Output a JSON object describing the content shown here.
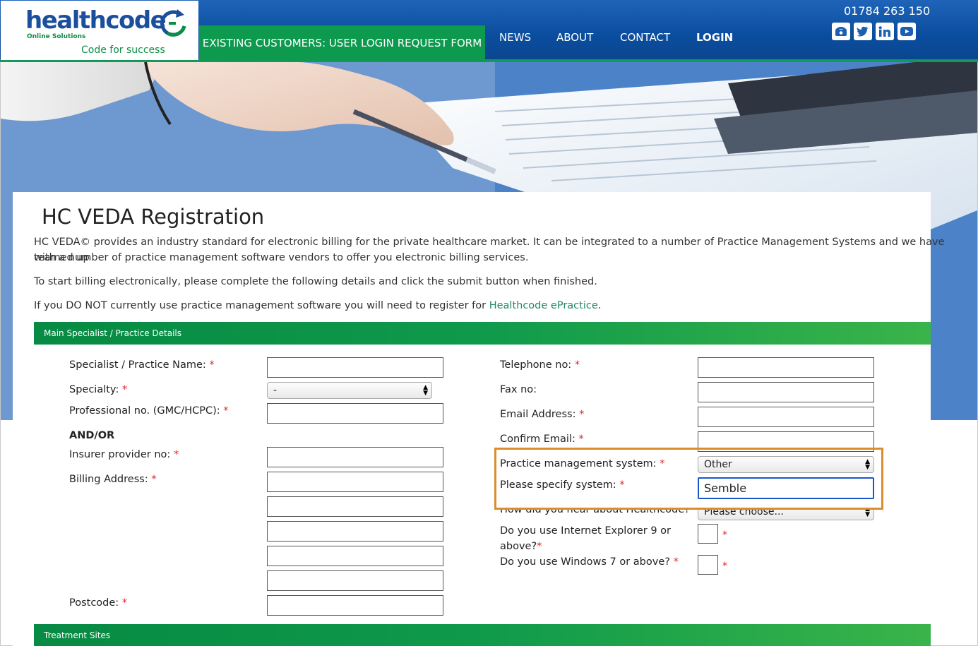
{
  "header": {
    "logo_word": "healthcode",
    "logo_sub": "Online Solutions",
    "logo_tagline": "Code for success",
    "phone": "01784 263 150",
    "nav": {
      "active": "EXISTING CUSTOMERS: USER LOGIN REQUEST FORM",
      "news": "NEWS",
      "about": "ABOUT",
      "contact": "CONTACT",
      "login": "LOGIN"
    }
  },
  "page": {
    "title": "HC VEDA Registration",
    "intro_line1": "HC VEDA© provides an industry standard for electronic billing for the private healthcare market. It can be integrated to a number of Practice Management Systems and we have teamed up",
    "intro_line2": "with a number of practice management software vendors to offer you electronic billing services.",
    "instructions": "To start billing electronically, please complete the following details and click the submit button when finished.",
    "no_pms_text": "If you DO NOT currently use practice management software you will need to register for ",
    "no_pms_link": "Healthcode ePractice",
    "no_pms_end": "."
  },
  "sections": {
    "main": "Main Specialist / Practice Details",
    "treatment": "Treatment Sites"
  },
  "form": {
    "specialist_name": "Specialist / Practice Name:",
    "specialty": "Specialty:",
    "specialty_value": "-",
    "professional_no": "Professional no. (GMC/HCPC):",
    "and_or": "AND/OR",
    "insurer_no": "Insurer provider no:",
    "billing_address": "Billing Address:",
    "postcode": "Postcode:",
    "telephone": "Telephone no:",
    "fax": "Fax no:",
    "email": "Email Address:",
    "confirm_email": "Confirm Email:",
    "pms": "Practice management system:",
    "pms_value": "Other",
    "specify": "Please specify system:",
    "specify_value": "Semble",
    "hear": "How did you hear about Healthcode?",
    "hear_value": "Please choose...",
    "ie9_line1": "Do you use Internet Explorer 9 or",
    "ie9_line2": "above?",
    "win7": "Do you use Windows 7 or above?",
    "required_mark": "*"
  },
  "colors": {
    "brand_blue": "#0a4d9e",
    "brand_green": "#0d9a4f",
    "highlight": "#d98e2b",
    "required": "#e0262a"
  }
}
